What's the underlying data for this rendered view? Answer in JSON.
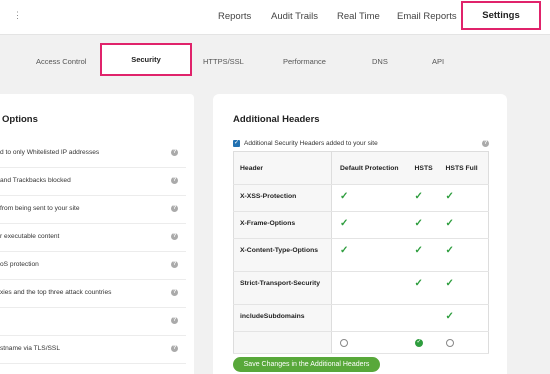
{
  "brand": {
    "dots": "⋮"
  },
  "top_nav": {
    "items": [
      "Reports",
      "Audit Trails",
      "Real Time",
      "Email Reports"
    ],
    "active": "Settings"
  },
  "sub_nav": {
    "items": [
      "Access Control",
      "HTTPS/SSL",
      "Performance",
      "DNS",
      "API"
    ],
    "active": "Security"
  },
  "left_panel": {
    "title": "Options",
    "rows": [
      "d to only Whitelisted IP addresses",
      "and Trackbacks blocked",
      " from being sent to your site",
      "r executable content",
      "oS protection",
      "xies and the top three attack countries",
      "",
      "stname via TLS/SSL"
    ],
    "help": "?"
  },
  "right_panel": {
    "title": "Additional Headers",
    "checkbox_label": "Additional Security Headers added to your site",
    "checkbox_checked": true,
    "help": "?",
    "table": {
      "headers": [
        "Header",
        "Default Protection",
        "HSTS",
        "HSTS Full"
      ],
      "rows": [
        {
          "name": "X-XSS-Protection",
          "default": true,
          "hsts": true,
          "hsts_full": true
        },
        {
          "name": "X-Frame-Options",
          "default": true,
          "hsts": true,
          "hsts_full": true
        },
        {
          "name": "X-Content-Type-Options",
          "default": true,
          "hsts": true,
          "hsts_full": true
        },
        {
          "name": "Strict-Transport-Security",
          "default": false,
          "hsts": true,
          "hsts_full": true
        },
        {
          "name": "includeSubdomains",
          "default": false,
          "hsts": false,
          "hsts_full": true
        }
      ],
      "selection": {
        "default": false,
        "hsts": true,
        "hsts_full": false
      }
    },
    "save_label": "Save Changes in the Additional Headers"
  },
  "colors": {
    "highlight": "#e0236b",
    "check": "#2e9d3e",
    "button": "#58a83a"
  }
}
